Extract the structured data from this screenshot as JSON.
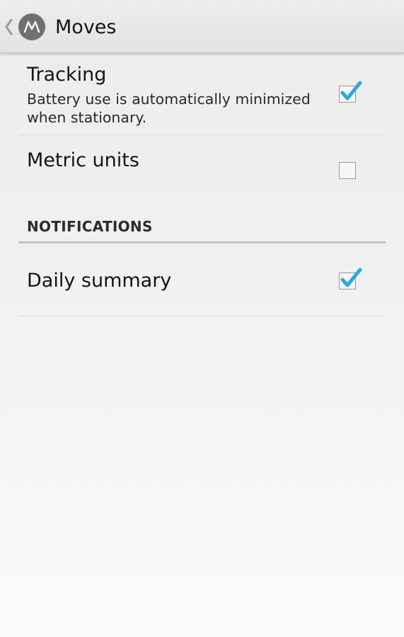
{
  "action_bar": {
    "title": "Moves",
    "logo_icon": "moves-logo-icon",
    "back_icon": "chevron-left-icon"
  },
  "preferences": [
    {
      "title": "Tracking",
      "summary": "Battery use is automatically minimized when stationary.",
      "checked": true
    },
    {
      "title": "Metric units",
      "summary": "",
      "checked": false
    }
  ],
  "notifications_section": {
    "header": "NOTIFICATIONS",
    "items": [
      {
        "title": "Daily summary",
        "checked": true
      }
    ]
  },
  "colors": {
    "checkmark": "#2aa8dc",
    "background": "#f1f1f1"
  }
}
